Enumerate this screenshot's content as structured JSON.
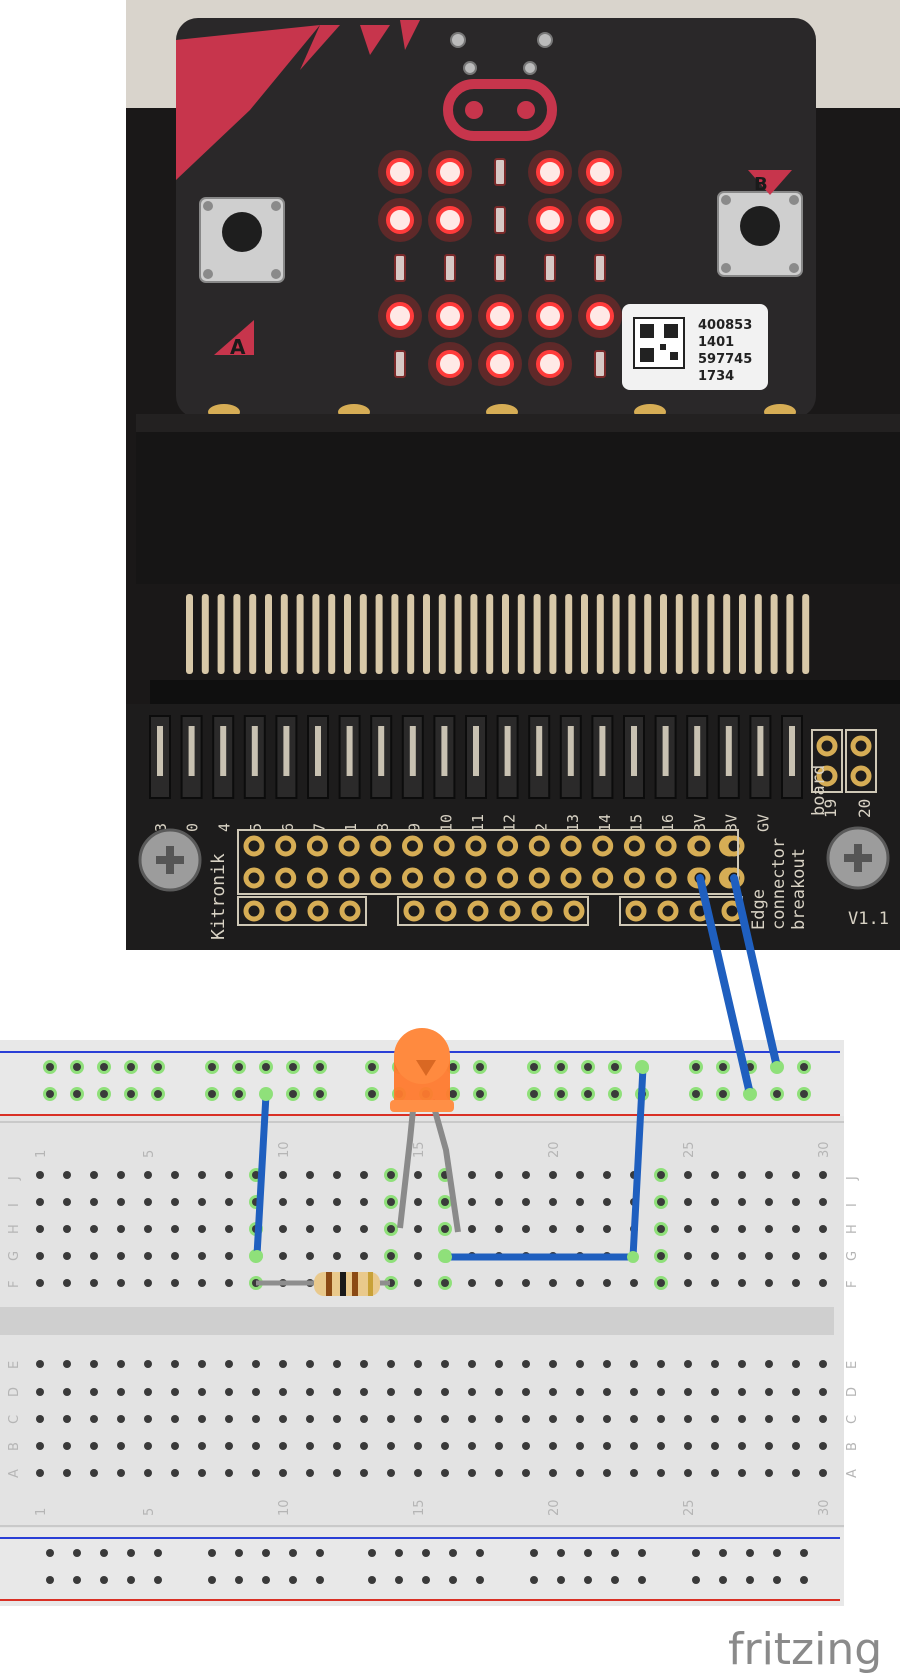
{
  "microbit": {
    "label_a": "A",
    "label_b": "B",
    "sticker_lines": [
      "400853",
      "1401",
      "597745",
      "1734"
    ],
    "led_matrix": [
      [
        1,
        1,
        0,
        1,
        1
      ],
      [
        1,
        1,
        0,
        1,
        1
      ],
      [
        0,
        0,
        0,
        0,
        0
      ],
      [
        1,
        1,
        1,
        1,
        1
      ],
      [
        0,
        1,
        1,
        1,
        0
      ]
    ]
  },
  "breakout": {
    "brand": "Kitronik",
    "title_lines": [
      "Edge",
      "connector",
      "breakout",
      "board"
    ],
    "version": "V1.1",
    "pin_labels": [
      "3",
      "0",
      "4",
      "5",
      "6",
      "7",
      "1",
      "8",
      "9",
      "10",
      "11",
      "12",
      "2",
      "13",
      "14",
      "15",
      "16",
      "3V",
      "3V",
      "GV"
    ],
    "side_pin_labels": [
      "19",
      "20"
    ]
  },
  "breadboard": {
    "column_numbers": [
      "1",
      "5",
      "10",
      "15",
      "20",
      "25",
      "30"
    ],
    "rows_top": [
      "J",
      "I",
      "H",
      "G",
      "F"
    ],
    "rows_bottom": [
      "E",
      "D",
      "C",
      "B",
      "A"
    ]
  },
  "colors": {
    "wire": "#1f5fbf",
    "led": "#ff7a2e",
    "highlight": "#8fe07a",
    "rail_red": "#d93025",
    "rail_blue": "#2a3fd6",
    "breadboard": "#e3e3e3",
    "pcb": "#1f1d1d",
    "led_on": "#ff2a2a"
  },
  "watermark": "fritzing"
}
